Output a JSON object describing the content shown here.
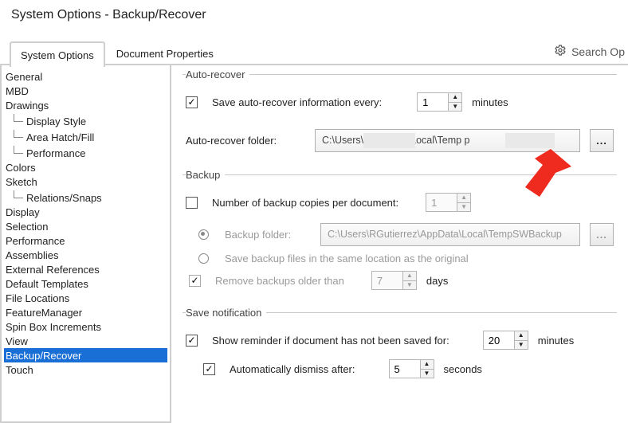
{
  "title": "System Options - Backup/Recover",
  "tabs": {
    "system_options": "System Options",
    "document_properties": "Document Properties"
  },
  "search_placeholder": "Search Op",
  "sidebar": {
    "items": [
      {
        "label": "General"
      },
      {
        "label": "MBD"
      },
      {
        "label": "Drawings"
      },
      {
        "label": "Display Style",
        "child": true
      },
      {
        "label": "Area Hatch/Fill",
        "child": true
      },
      {
        "label": "Performance",
        "child": true
      },
      {
        "label": "Colors"
      },
      {
        "label": "Sketch"
      },
      {
        "label": "Relations/Snaps",
        "child": true
      },
      {
        "label": "Display"
      },
      {
        "label": "Selection"
      },
      {
        "label": "Performance"
      },
      {
        "label": "Assemblies"
      },
      {
        "label": "External References"
      },
      {
        "label": "Default Templates"
      },
      {
        "label": "File Locations"
      },
      {
        "label": "FeatureManager"
      },
      {
        "label": "Spin Box Increments"
      },
      {
        "label": "View"
      },
      {
        "label": "Backup/Recover",
        "selected": true
      },
      {
        "label": "Touch"
      }
    ]
  },
  "auto_recover": {
    "legend": "Auto-recover",
    "save_info": "Save auto-recover information every:",
    "value": "1",
    "unit": "minutes",
    "folder_label": "Auto-recover folder:",
    "folder_value": "C:\\Users\\                 \\AppData\\Local\\Temp               p",
    "browse": "..."
  },
  "backup": {
    "legend": "Backup",
    "copies_label": "Number of backup copies per document:",
    "copies_value": "1",
    "folder_label": "Backup folder:",
    "folder_value": "C:\\Users\\RGutierrez\\AppData\\Local\\TempSWBackup",
    "same_location": "Save backup files in the same location as the original",
    "remove_label": "Remove backups older than",
    "remove_value": "7",
    "remove_unit": "days",
    "browse": "..."
  },
  "save_notification": {
    "legend": "Save notification",
    "reminder_label": "Show reminder if document has not been saved for:",
    "reminder_value": "20",
    "reminder_unit": "minutes",
    "dismiss_label": "Automatically dismiss after:",
    "dismiss_value": "5",
    "dismiss_unit": "seconds"
  }
}
